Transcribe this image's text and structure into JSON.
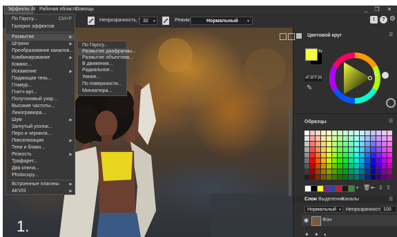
{
  "menubar": {
    "items": [
      {
        "label": "Эффекты",
        "active": true
      },
      {
        "label": "AI",
        "active": false
      },
      {
        "label": "Рабочая область",
        "active": false
      },
      {
        "label": "Помощь",
        "active": false
      }
    ],
    "window_buttons": [
      "_",
      "❐",
      "✕"
    ]
  },
  "toolbar": {
    "opacity_label": "Непрозрачность, %",
    "opacity_value": "32",
    "mode_label": "Режим:",
    "mode_value": "Нормальный",
    "info_icons": [
      "!",
      "?",
      "⚙"
    ]
  },
  "effects_menu": {
    "items": [
      {
        "label": "По Гауссу...",
        "shortcut": "Ctrl+F",
        "arrow": false
      },
      {
        "label": "Галерея эффектов",
        "shortcut": "",
        "arrow": false
      },
      {
        "label": "Размытие",
        "shortcut": "",
        "arrow": true,
        "highlighted": true
      },
      {
        "label": "Штрихи",
        "shortcut": "",
        "arrow": true
      },
      {
        "label": "Преобразование каналов...",
        "shortcut": "",
        "arrow": false
      },
      {
        "label": "Комбинирование",
        "shortcut": "",
        "arrow": true
      },
      {
        "label": "Комикс...",
        "shortcut": "",
        "arrow": false
      },
      {
        "label": "Искажение",
        "shortcut": "",
        "arrow": true
      },
      {
        "label": "Падающая тень...",
        "shortcut": "",
        "arrow": false
      },
      {
        "label": "Гламур...",
        "shortcut": "",
        "arrow": false
      },
      {
        "label": "Глитч-арт...",
        "shortcut": "",
        "arrow": false
      },
      {
        "label": "Полутоновый узор...",
        "shortcut": "",
        "arrow": false
      },
      {
        "label": "Высокие частоты...",
        "shortcut": "",
        "arrow": false
      },
      {
        "label": "Линогравюра...",
        "shortcut": "",
        "arrow": false
      },
      {
        "label": "Шум",
        "shortcut": "",
        "arrow": true
      },
      {
        "label": "Загнутый уголок...",
        "shortcut": "",
        "arrow": false
      },
      {
        "label": "Перо и чернила...",
        "shortcut": "",
        "arrow": false
      },
      {
        "label": "Пикселизация",
        "shortcut": "",
        "arrow": true
      },
      {
        "label": "Тени и блики...",
        "shortcut": "",
        "arrow": false
      },
      {
        "label": "Резкость",
        "shortcut": "",
        "arrow": true
      },
      {
        "label": "Трафарет...",
        "shortcut": "",
        "arrow": false
      },
      {
        "label": "Два ключа...",
        "shortcut": "",
        "arrow": false
      },
      {
        "label": "Photocopy...",
        "shortcut": "",
        "arrow": false
      },
      {
        "label": "Встроенные плагины",
        "shortcut": "",
        "arrow": true
      },
      {
        "label": "AKVIS",
        "shortcut": "",
        "arrow": true
      }
    ]
  },
  "blur_submenu": {
    "items": [
      {
        "label": "По Гауссу..."
      },
      {
        "label": "Размытие диафрагмы...",
        "highlighted": true
      },
      {
        "label": "Размытие объектива..."
      },
      {
        "label": "В движении..."
      },
      {
        "label": "Радиальное..."
      },
      {
        "label": "Умное..."
      },
      {
        "label": "По поверхности..."
      },
      {
        "label": "Миниатюра..."
      }
    ]
  },
  "color_panel": {
    "title": "Цветовой круг",
    "hex_value": "#F3FF39",
    "foreground_color": "#f3ff39",
    "background_color": "#000000"
  },
  "samples_panel": {
    "title": "Образцы"
  },
  "layers_panel": {
    "tabs": [
      "Слои",
      "Выделение",
      "Каналы"
    ],
    "blend_mode": "Нормальный",
    "opacity_label": "Непрозрачность",
    "opacity_value": "100",
    "layer_name": "Фон"
  },
  "canvas": {
    "step_number": "1."
  }
}
